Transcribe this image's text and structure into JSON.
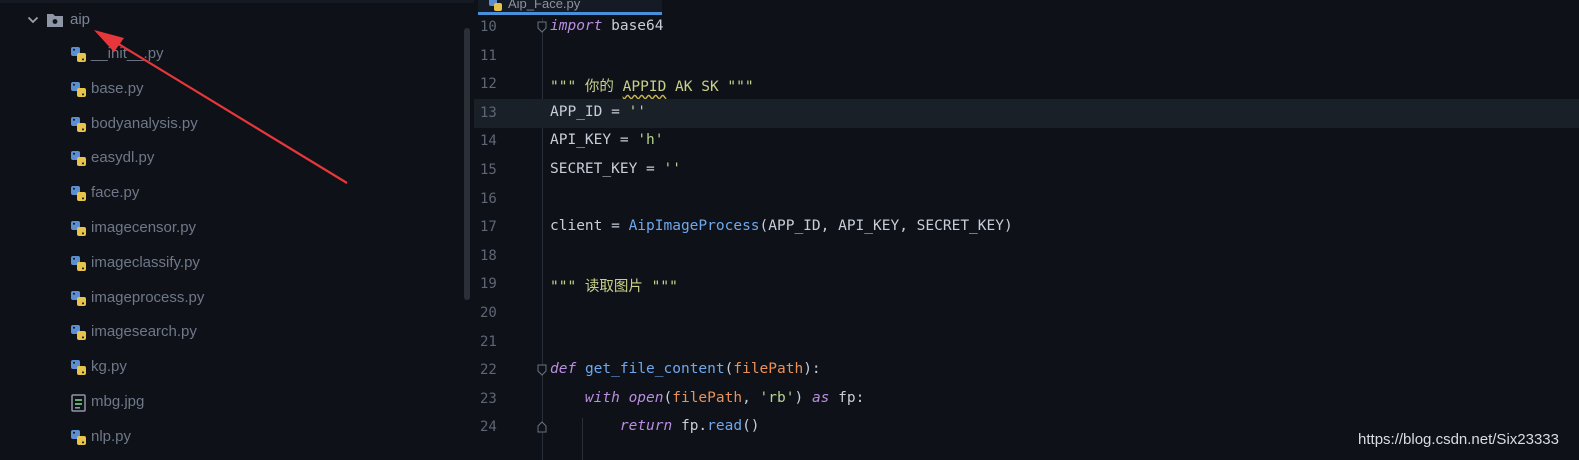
{
  "project_tree": {
    "folder": {
      "name": "aip",
      "icon": "folder-icon"
    },
    "files": [
      {
        "name": "__init__.py",
        "icon": "python-file-icon"
      },
      {
        "name": "base.py",
        "icon": "python-file-icon"
      },
      {
        "name": "bodyanalysis.py",
        "icon": "python-file-icon"
      },
      {
        "name": "easydl.py",
        "icon": "python-file-icon"
      },
      {
        "name": "face.py",
        "icon": "python-file-icon"
      },
      {
        "name": "imagecensor.py",
        "icon": "python-file-icon"
      },
      {
        "name": "imageclassify.py",
        "icon": "python-file-icon"
      },
      {
        "name": "imageprocess.py",
        "icon": "python-file-icon"
      },
      {
        "name": "imagesearch.py",
        "icon": "python-file-icon"
      },
      {
        "name": "kg.py",
        "icon": "python-file-icon"
      },
      {
        "name": "mbg.jpg",
        "icon": "image-file-icon"
      },
      {
        "name": "nlp.py",
        "icon": "python-file-icon"
      }
    ]
  },
  "editor": {
    "tab": {
      "label": "Aip_Face.py",
      "icon": "python-file-icon"
    },
    "current_line": "13",
    "lines": [
      {
        "num": "10",
        "tokens": [
          {
            "t": "import",
            "c": "kw"
          },
          {
            "t": " base64",
            "c": "plain"
          }
        ]
      },
      {
        "num": "11",
        "tokens": []
      },
      {
        "num": "12",
        "tokens": [
          {
            "t": "\"\"\" 你的 ",
            "c": "doc"
          },
          {
            "t": "APPID",
            "c": "doc squig"
          },
          {
            "t": " AK SK \"\"\"",
            "c": "doc"
          }
        ]
      },
      {
        "num": "13",
        "tokens": [
          {
            "t": "APP_ID = ",
            "c": "plain"
          },
          {
            "t": "''",
            "c": "str"
          }
        ]
      },
      {
        "num": "14",
        "tokens": [
          {
            "t": "API_KEY = ",
            "c": "plain"
          },
          {
            "t": "'h'",
            "c": "str"
          }
        ]
      },
      {
        "num": "15",
        "tokens": [
          {
            "t": "SECRET_KEY = ",
            "c": "plain"
          },
          {
            "t": "''",
            "c": "str"
          }
        ]
      },
      {
        "num": "16",
        "tokens": []
      },
      {
        "num": "17",
        "tokens": [
          {
            "t": "client = ",
            "c": "plain"
          },
          {
            "t": "AipImageProcess",
            "c": "fn"
          },
          {
            "t": "(APP_ID, API_KEY, SECRET_KEY)",
            "c": "plain"
          }
        ]
      },
      {
        "num": "18",
        "tokens": []
      },
      {
        "num": "19",
        "tokens": [
          {
            "t": "\"\"\" 读取图片 \"\"\"",
            "c": "doc"
          }
        ]
      },
      {
        "num": "20",
        "tokens": []
      },
      {
        "num": "21",
        "tokens": []
      },
      {
        "num": "22",
        "tokens": [
          {
            "t": "def",
            "c": "kw"
          },
          {
            "t": " ",
            "c": "plain"
          },
          {
            "t": "get_file_content",
            "c": "fn"
          },
          {
            "t": "(",
            "c": "plain"
          },
          {
            "t": "filePath",
            "c": "param"
          },
          {
            "t": "):",
            "c": "plain"
          }
        ]
      },
      {
        "num": "23",
        "tokens": [
          {
            "t": "    ",
            "c": "plain"
          },
          {
            "t": "with",
            "c": "kw"
          },
          {
            "t": " ",
            "c": "plain"
          },
          {
            "t": "open",
            "c": "kw"
          },
          {
            "t": "(",
            "c": "plain"
          },
          {
            "t": "filePath",
            "c": "param"
          },
          {
            "t": ", ",
            "c": "plain"
          },
          {
            "t": "'rb'",
            "c": "str"
          },
          {
            "t": ") ",
            "c": "plain"
          },
          {
            "t": "as",
            "c": "kw"
          },
          {
            "t": " fp:",
            "c": "plain"
          }
        ]
      },
      {
        "num": "24",
        "tokens": [
          {
            "t": "        ",
            "c": "plain"
          },
          {
            "t": "return",
            "c": "kw"
          },
          {
            "t": " fp.",
            "c": "plain"
          },
          {
            "t": "read",
            "c": "fn"
          },
          {
            "t": "()",
            "c": "plain"
          }
        ]
      }
    ]
  },
  "watermark": "https://blog.csdn.net/Six23333",
  "colors": {
    "arrow": "#e8373a",
    "tab_underline": "#4a8fd9"
  }
}
